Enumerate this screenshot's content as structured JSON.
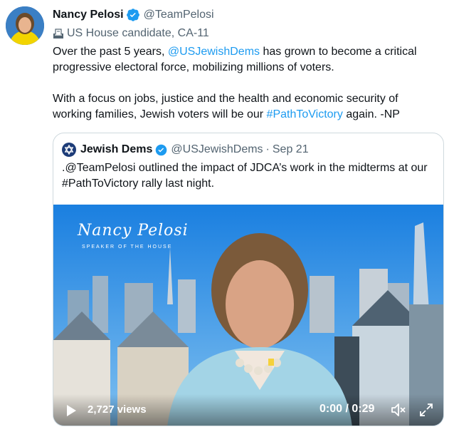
{
  "tweet": {
    "author_name": "Nancy Pelosi",
    "handle": "@TeamPelosi",
    "label_icon": "ballot-box-icon",
    "label": "US House candidate, CA-11",
    "text": {
      "p1_a": "Over the past 5 years, ",
      "p1_link": "@USJewishDems",
      "p1_b": " has grown to become a critical progressive electoral force, mobilizing millions of voters.",
      "p2_a": "With a focus on jobs, justice and the health and economic security of working families, Jewish voters will be our ",
      "p2_link": "#PathToVictory",
      "p2_b": " again. -NP"
    }
  },
  "quote": {
    "author_name": "Jewish Dems",
    "handle": "@USJewishDems",
    "separator": "·",
    "date": "Sep 21",
    "text": ".@TeamPelosi outlined the impact of JDCA’s work in the midterms at our #PathToVictory rally last night.",
    "video": {
      "overlay_title": "Nancy Pelosi",
      "overlay_subtitle": "SPEAKER OF THE HOUSE",
      "views": "2,727 views",
      "time": "0:00 / 0:29"
    }
  },
  "colors": {
    "link": "#1d9bf0",
    "verified": "#1d9bf0",
    "secondary_text": "#536471",
    "border": "#cfd9de"
  }
}
